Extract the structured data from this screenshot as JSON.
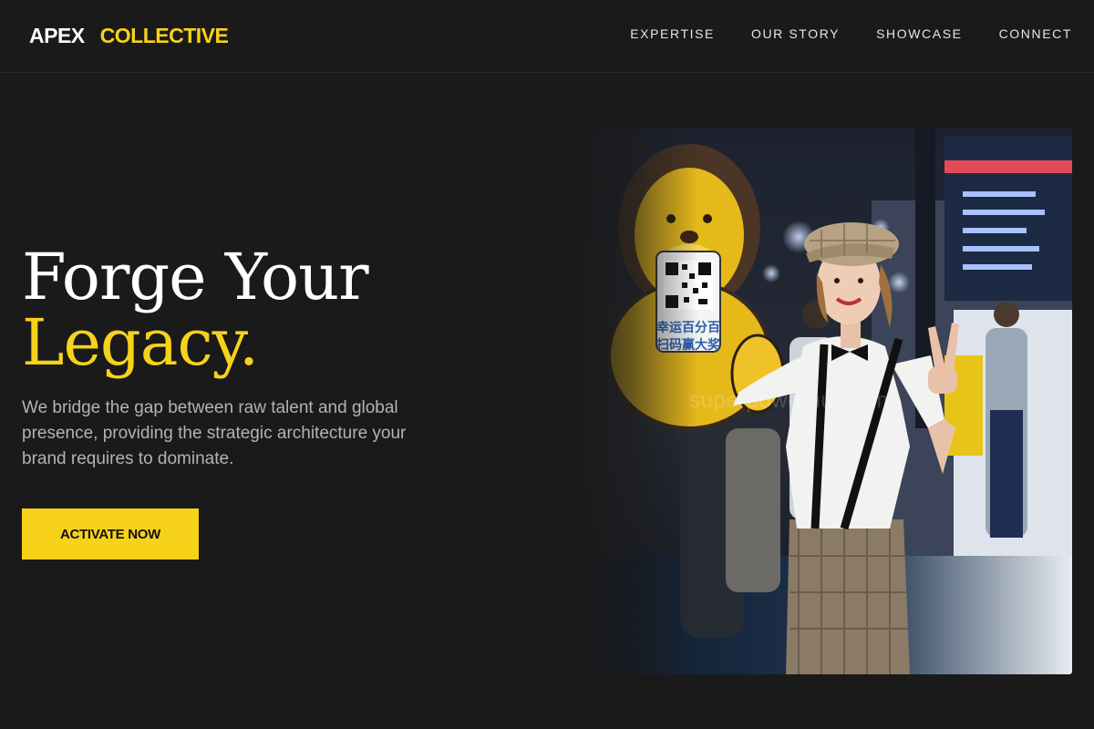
{
  "header": {
    "logo_part1": "APEX",
    "logo_part2": "COLLECTIVE",
    "nav": [
      {
        "label": "EXPERTISE"
      },
      {
        "label": "OUR STORY"
      },
      {
        "label": "SHOWCASE"
      },
      {
        "label": "CONNECT"
      }
    ]
  },
  "hero": {
    "headline_line1": "Forge Your",
    "headline_line2": "Legacy.",
    "description": "We bridge the gap between raw talent and global presence, providing the strategic architecture your brand requires to dominate.",
    "cta_label": "ACTIVATE NOW",
    "image": {
      "description": "Woman in newsboy cap, white shirt, bow tie and suspenders making peace sign next to yellow lion mascot sign holding QR code at an exhibition",
      "sign_text_line1": "幸运百分百",
      "sign_text_line2": "扫码赢大奖",
      "watermark": "superpowerhub.com"
    }
  },
  "colors": {
    "background": "#1a1a1a",
    "accent": "#f7d21a",
    "text_primary": "#ffffff",
    "text_secondary": "#b3b3b3"
  }
}
